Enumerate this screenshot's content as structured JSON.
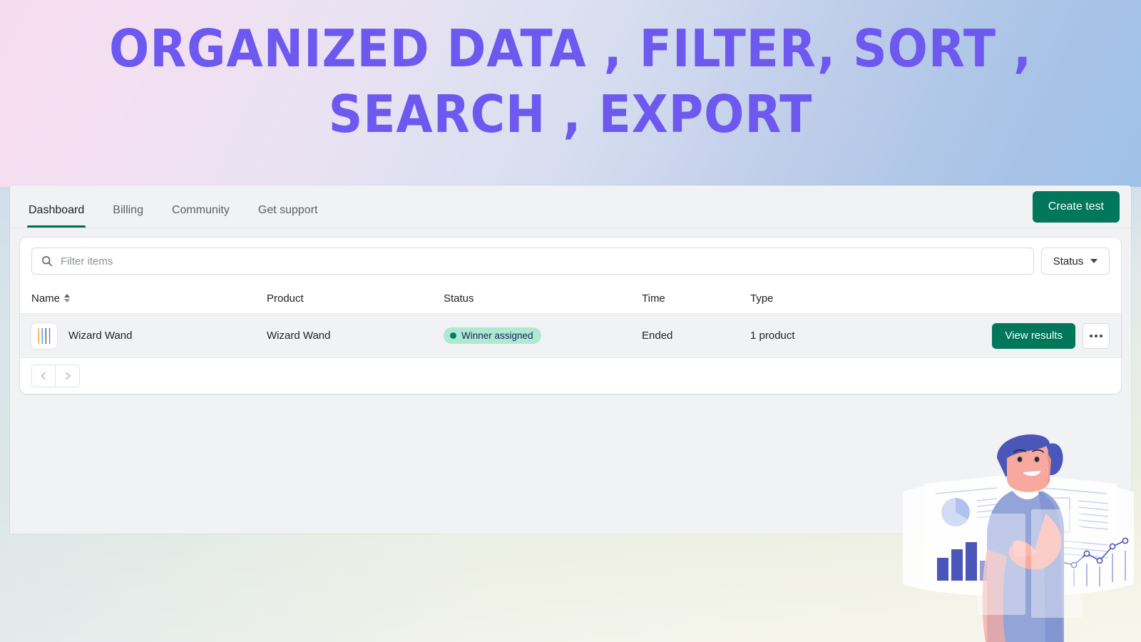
{
  "hero": {
    "heading": "ORGANIZED DATA , FILTER, SORT ,\nSEARCH , EXPORT",
    "heading_color": "#6d58f0"
  },
  "topbar": {
    "tabs": [
      {
        "label": "Dashboard",
        "active": true
      },
      {
        "label": "Billing",
        "active": false
      },
      {
        "label": "Community",
        "active": false
      },
      {
        "label": "Get support",
        "active": false
      }
    ],
    "primary_action": "Create test",
    "primary_action_color": "#00765a",
    "active_tab_underline_color": "#00704b"
  },
  "filters": {
    "search_placeholder": "Filter items",
    "search_value": "",
    "search_icon": "search-icon",
    "status_button_label": "Status",
    "status_caret_icon": "chevron-down-icon"
  },
  "table": {
    "columns": [
      {
        "key": "name",
        "label": "Name",
        "sortable": true,
        "sort_icon": "sort-icon"
      },
      {
        "key": "product",
        "label": "Product",
        "sortable": false
      },
      {
        "key": "status",
        "label": "Status",
        "sortable": false
      },
      {
        "key": "time",
        "label": "Time",
        "sortable": false
      },
      {
        "key": "type",
        "label": "Type",
        "sortable": false
      }
    ],
    "rows": [
      {
        "thumbnail": "wand-product-thumbnail",
        "name": "Wizard Wand",
        "product": "Wizard Wand",
        "status": "Winner assigned",
        "status_dot_color": "#008060",
        "status_bg_color": "#aee9d1",
        "time": "Ended",
        "type": "1 product",
        "primary_action": "View results",
        "more_actions_icon": "ellipsis-icon"
      }
    ]
  },
  "pagination": {
    "previous_icon": "chevron-left-icon",
    "next_icon": "chevron-right-icon"
  },
  "illustration": {
    "name": "analytics-person-illustration"
  }
}
